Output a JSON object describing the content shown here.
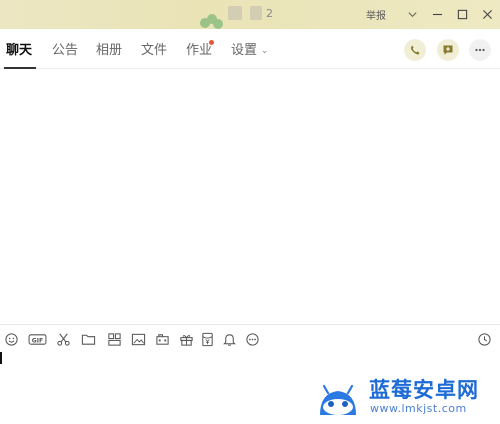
{
  "titlebar": {
    "name_partial": "2",
    "report_label": "举报",
    "controls": [
      "menu",
      "minimize",
      "maximize",
      "close"
    ]
  },
  "tabs": [
    {
      "label": "聊天",
      "active": true,
      "badge": false
    },
    {
      "label": "公告",
      "active": false,
      "badge": false
    },
    {
      "label": "相册",
      "active": false,
      "badge": false
    },
    {
      "label": "文件",
      "active": false,
      "badge": false
    },
    {
      "label": "作业",
      "active": false,
      "badge": true
    },
    {
      "label": "设置",
      "active": false,
      "badge": false,
      "dropdown": true
    }
  ],
  "header_actions": [
    "phone-icon",
    "add-message-icon",
    "more-icon"
  ],
  "toolbar_tools": [
    "emoji-icon",
    "gif-icon",
    "scissors-icon",
    "folder-icon",
    "sticker-icon",
    "image-icon",
    "camera-icon",
    "gift-icon",
    "red-packet-icon",
    "bell-icon",
    "more-icon",
    "history-clock-icon"
  ],
  "colors": {
    "title_bg": "#ece7c2",
    "badge_red": "#e8553a",
    "watermark_blue": "#1e6bd6"
  },
  "watermark": {
    "title": "蓝莓安卓网",
    "url": "www.lmkjst.com"
  }
}
